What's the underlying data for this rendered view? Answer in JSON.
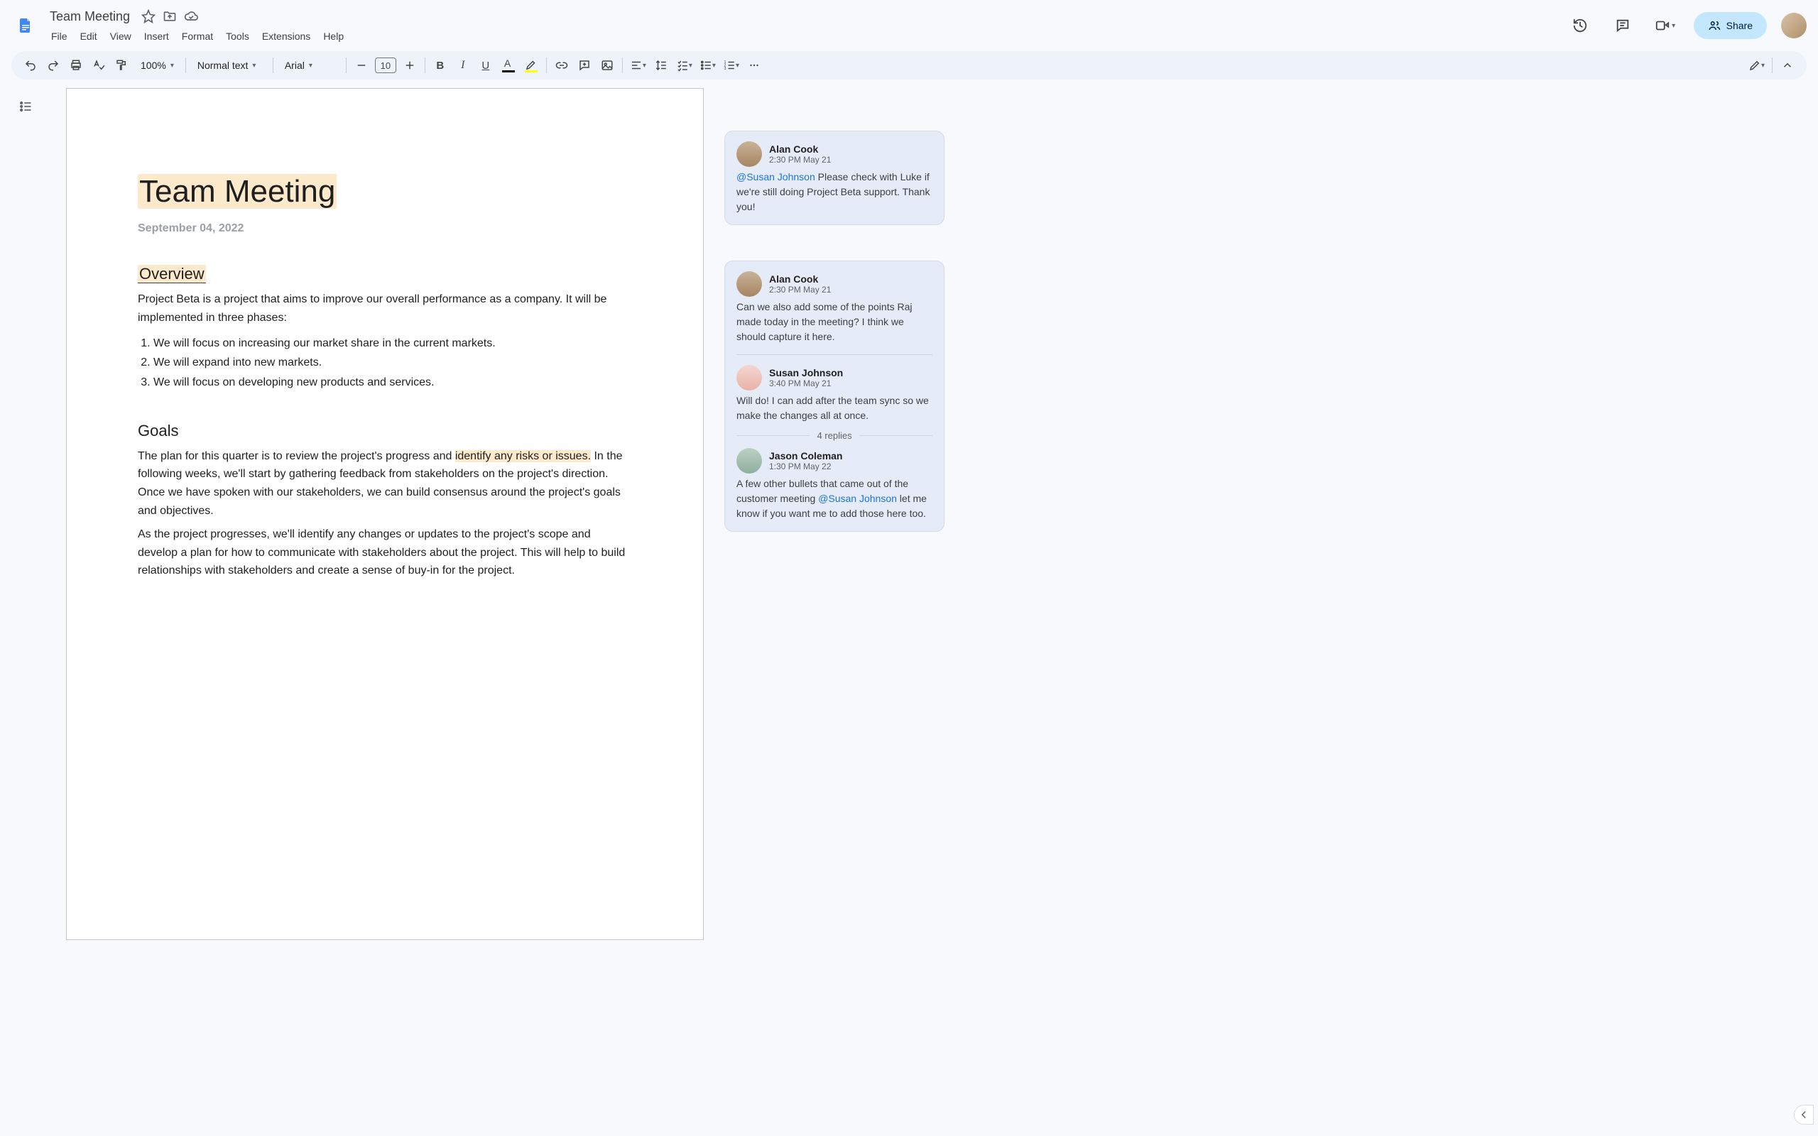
{
  "header": {
    "title": "Team Meeting",
    "menus": [
      "File",
      "Edit",
      "View",
      "Insert",
      "Format",
      "Tools",
      "Extensions",
      "Help"
    ],
    "share_label": "Share"
  },
  "toolbar": {
    "zoom": "100%",
    "style": "Normal text",
    "font": "Arial",
    "font_size": "10"
  },
  "doc": {
    "title": "Team Meeting",
    "date": "September 04, 2022",
    "overview_h": "Overview",
    "overview_p": "Project Beta is a project that aims to improve our overall performance as a company. It will be implemented in three phases:",
    "phases": [
      "We will focus on increasing our market share in the current markets.",
      "We will expand into new markets.",
      "We will focus on developing new products and services."
    ],
    "goals_h": "Goals",
    "goals_p1_pre": "The plan for this quarter is to review the project's progress and ",
    "goals_p1_hl": "identify any risks or issues.",
    "goals_p1_post": " In the following weeks, we'll start by gathering feedback from stakeholders on the project's direction. Once we have spoken with our stakeholders, we can build consensus around the project's goals and objectives.",
    "goals_p2": "As the project progresses, we'll identify any changes or updates to the project's scope and develop a plan for how to communicate with stakeholders about the project. This will help to build relationships with stakeholders and create a sense of buy-in for the project."
  },
  "comments": {
    "c1": {
      "author": "Alan Cook",
      "time": "2:30 PM May 21",
      "mention": "@Susan Johnson",
      "text": " Please check with Luke if we're still doing Project Beta support. Thank you!"
    },
    "c2": {
      "a": {
        "author": "Alan Cook",
        "time": "2:30 PM May 21",
        "text": "Can we also add some of the points Raj made today in the meeting? I think we should capture it here."
      },
      "b": {
        "author": "Susan Johnson",
        "time": "3:40 PM May 21",
        "text": "Will do! I can add after the team sync so we make the changes all at once."
      },
      "replies_label": "4 replies",
      "c": {
        "author": "Jason Coleman",
        "time": "1:30 PM May 22",
        "pre": "A few other bullets that came out of the customer meeting ",
        "mention": "@Susan Johnson",
        "post": " let me know if you want me to add those here too."
      }
    }
  }
}
